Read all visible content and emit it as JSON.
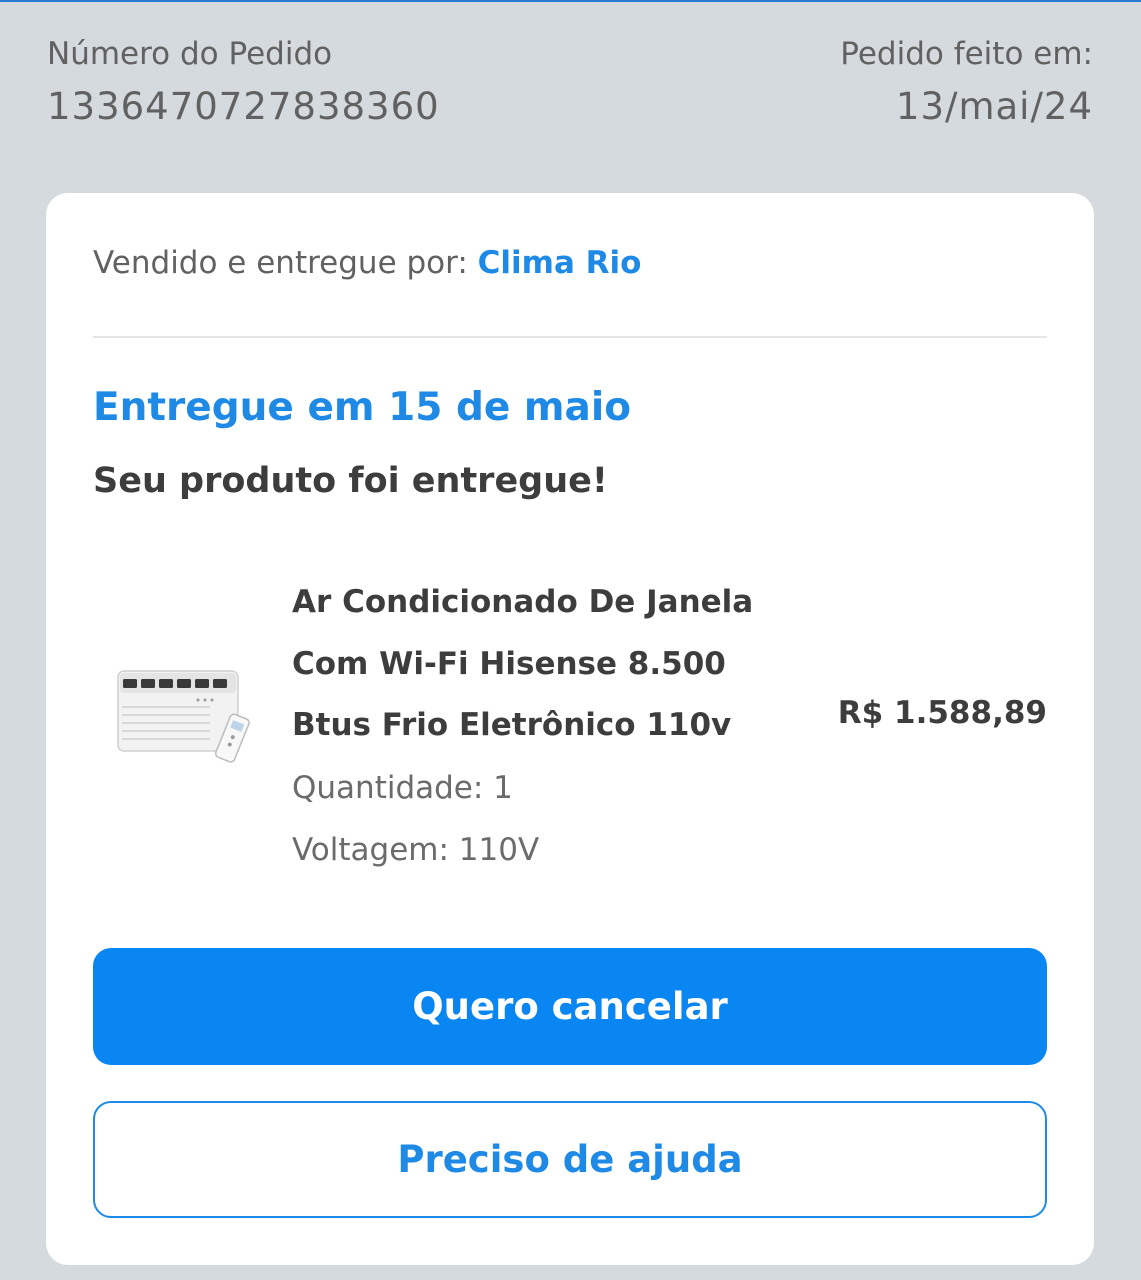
{
  "order": {
    "number_label": "Número do Pedido",
    "number_value": "1336470727838360",
    "date_label": "Pedido feito em:",
    "date_value": "13/mai/24"
  },
  "seller": {
    "label": "Vendido e entregue por:",
    "name": "Clima Rio"
  },
  "delivery": {
    "title": "Entregue em 15 de maio",
    "subtitle": "Seu produto foi entregue!"
  },
  "product": {
    "name_lines": [
      "Ar Condicionado De Janela",
      "Com Wi-Fi Hisense 8.500",
      "Btus Frio Eletrônico 110v"
    ],
    "quantity": "Quantidade: 1",
    "voltage": "Voltagem: 110V",
    "price": "R$ 1.588,89",
    "image_icon": "air-conditioner-icon"
  },
  "actions": {
    "cancel_label": "Quero cancelar",
    "help_label": "Preciso de ajuda"
  },
  "colors": {
    "accent": "#1f8ae6",
    "button_primary": "#0a86f3",
    "background": "#d4dadd",
    "text_dark": "#3d3d3d",
    "text_muted": "#616161"
  }
}
